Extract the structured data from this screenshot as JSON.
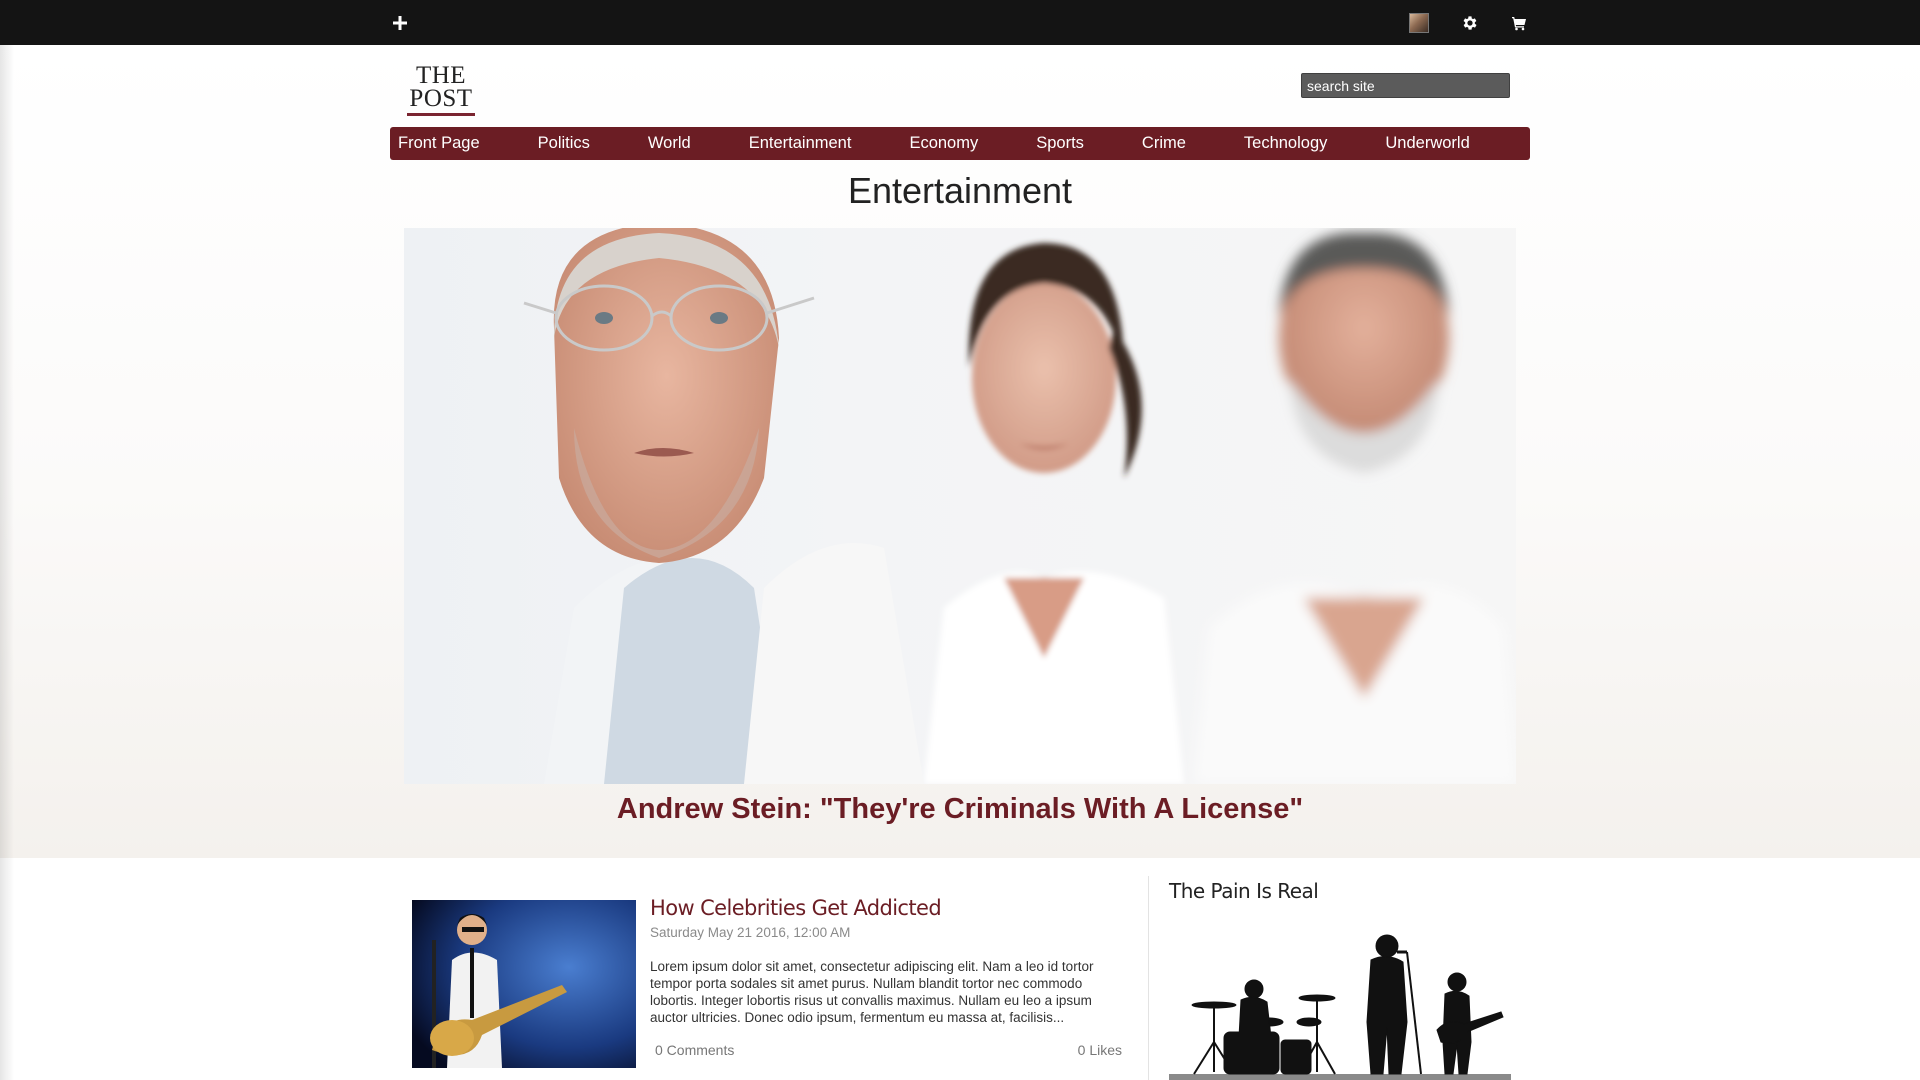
{
  "topbar": {
    "add_icon": "plus-icon",
    "avatar_icon": "user-avatar",
    "settings_icon": "gear-icon",
    "cart_icon": "cart-icon"
  },
  "header": {
    "logo_line1": "THE",
    "logo_line2": "POST",
    "search_placeholder": "search site"
  },
  "nav": {
    "items": [
      {
        "label": "Front Page"
      },
      {
        "label": "Politics"
      },
      {
        "label": "World"
      },
      {
        "label": "Entertainment"
      },
      {
        "label": "Economy"
      },
      {
        "label": "Sports"
      },
      {
        "label": "Crime"
      },
      {
        "label": "Technology"
      },
      {
        "label": "Underworld"
      }
    ]
  },
  "page": {
    "section_title": "Entertainment"
  },
  "hero": {
    "title": "Andrew Stein: \"They're Criminals With A License\""
  },
  "article": {
    "title": "How Celebrities Get Addicted",
    "date": "Saturday May 21 2016, 12:00 AM",
    "excerpt": "Lorem ipsum dolor sit amet, consectetur adipiscing elit. Nam a leo id tortor tempor porta sodales sit amet purus. Nullam blandit tortor nec commodo lobortis. Integer lobortis risus ut convallis maximus. Nullam eu leo a ipsum auctor ultricies. Donec odio ipsum, fermentum eu massa at, facilisis...",
    "comments": "0 Comments",
    "likes": "0 Likes"
  },
  "sidebar": {
    "title": "The Pain Is Real"
  },
  "colors": {
    "brand": "#6b1d24",
    "topbar": "#141414",
    "search_bg": "#5b5b5b"
  }
}
